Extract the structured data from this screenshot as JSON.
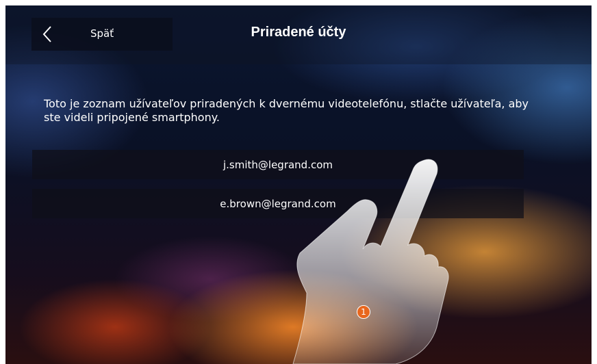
{
  "header": {
    "back_label": "Späť",
    "title": "Priradené účty"
  },
  "description": "Toto je zoznam užívateľov priradených k dvernému videotelefónu, stlačte užívateľa, aby ste videli pripojené smartphony.",
  "accounts": [
    {
      "email": "j.smith@legrand.com"
    },
    {
      "email": "e.brown@legrand.com"
    }
  ],
  "annotation": {
    "step_number": "1"
  },
  "colors": {
    "accent": "#e8671e",
    "bar_bg": "#0f0f19",
    "text": "#ffffff"
  },
  "icons": {
    "back": "chevron-left-icon",
    "hand": "pointing-hand-icon"
  }
}
